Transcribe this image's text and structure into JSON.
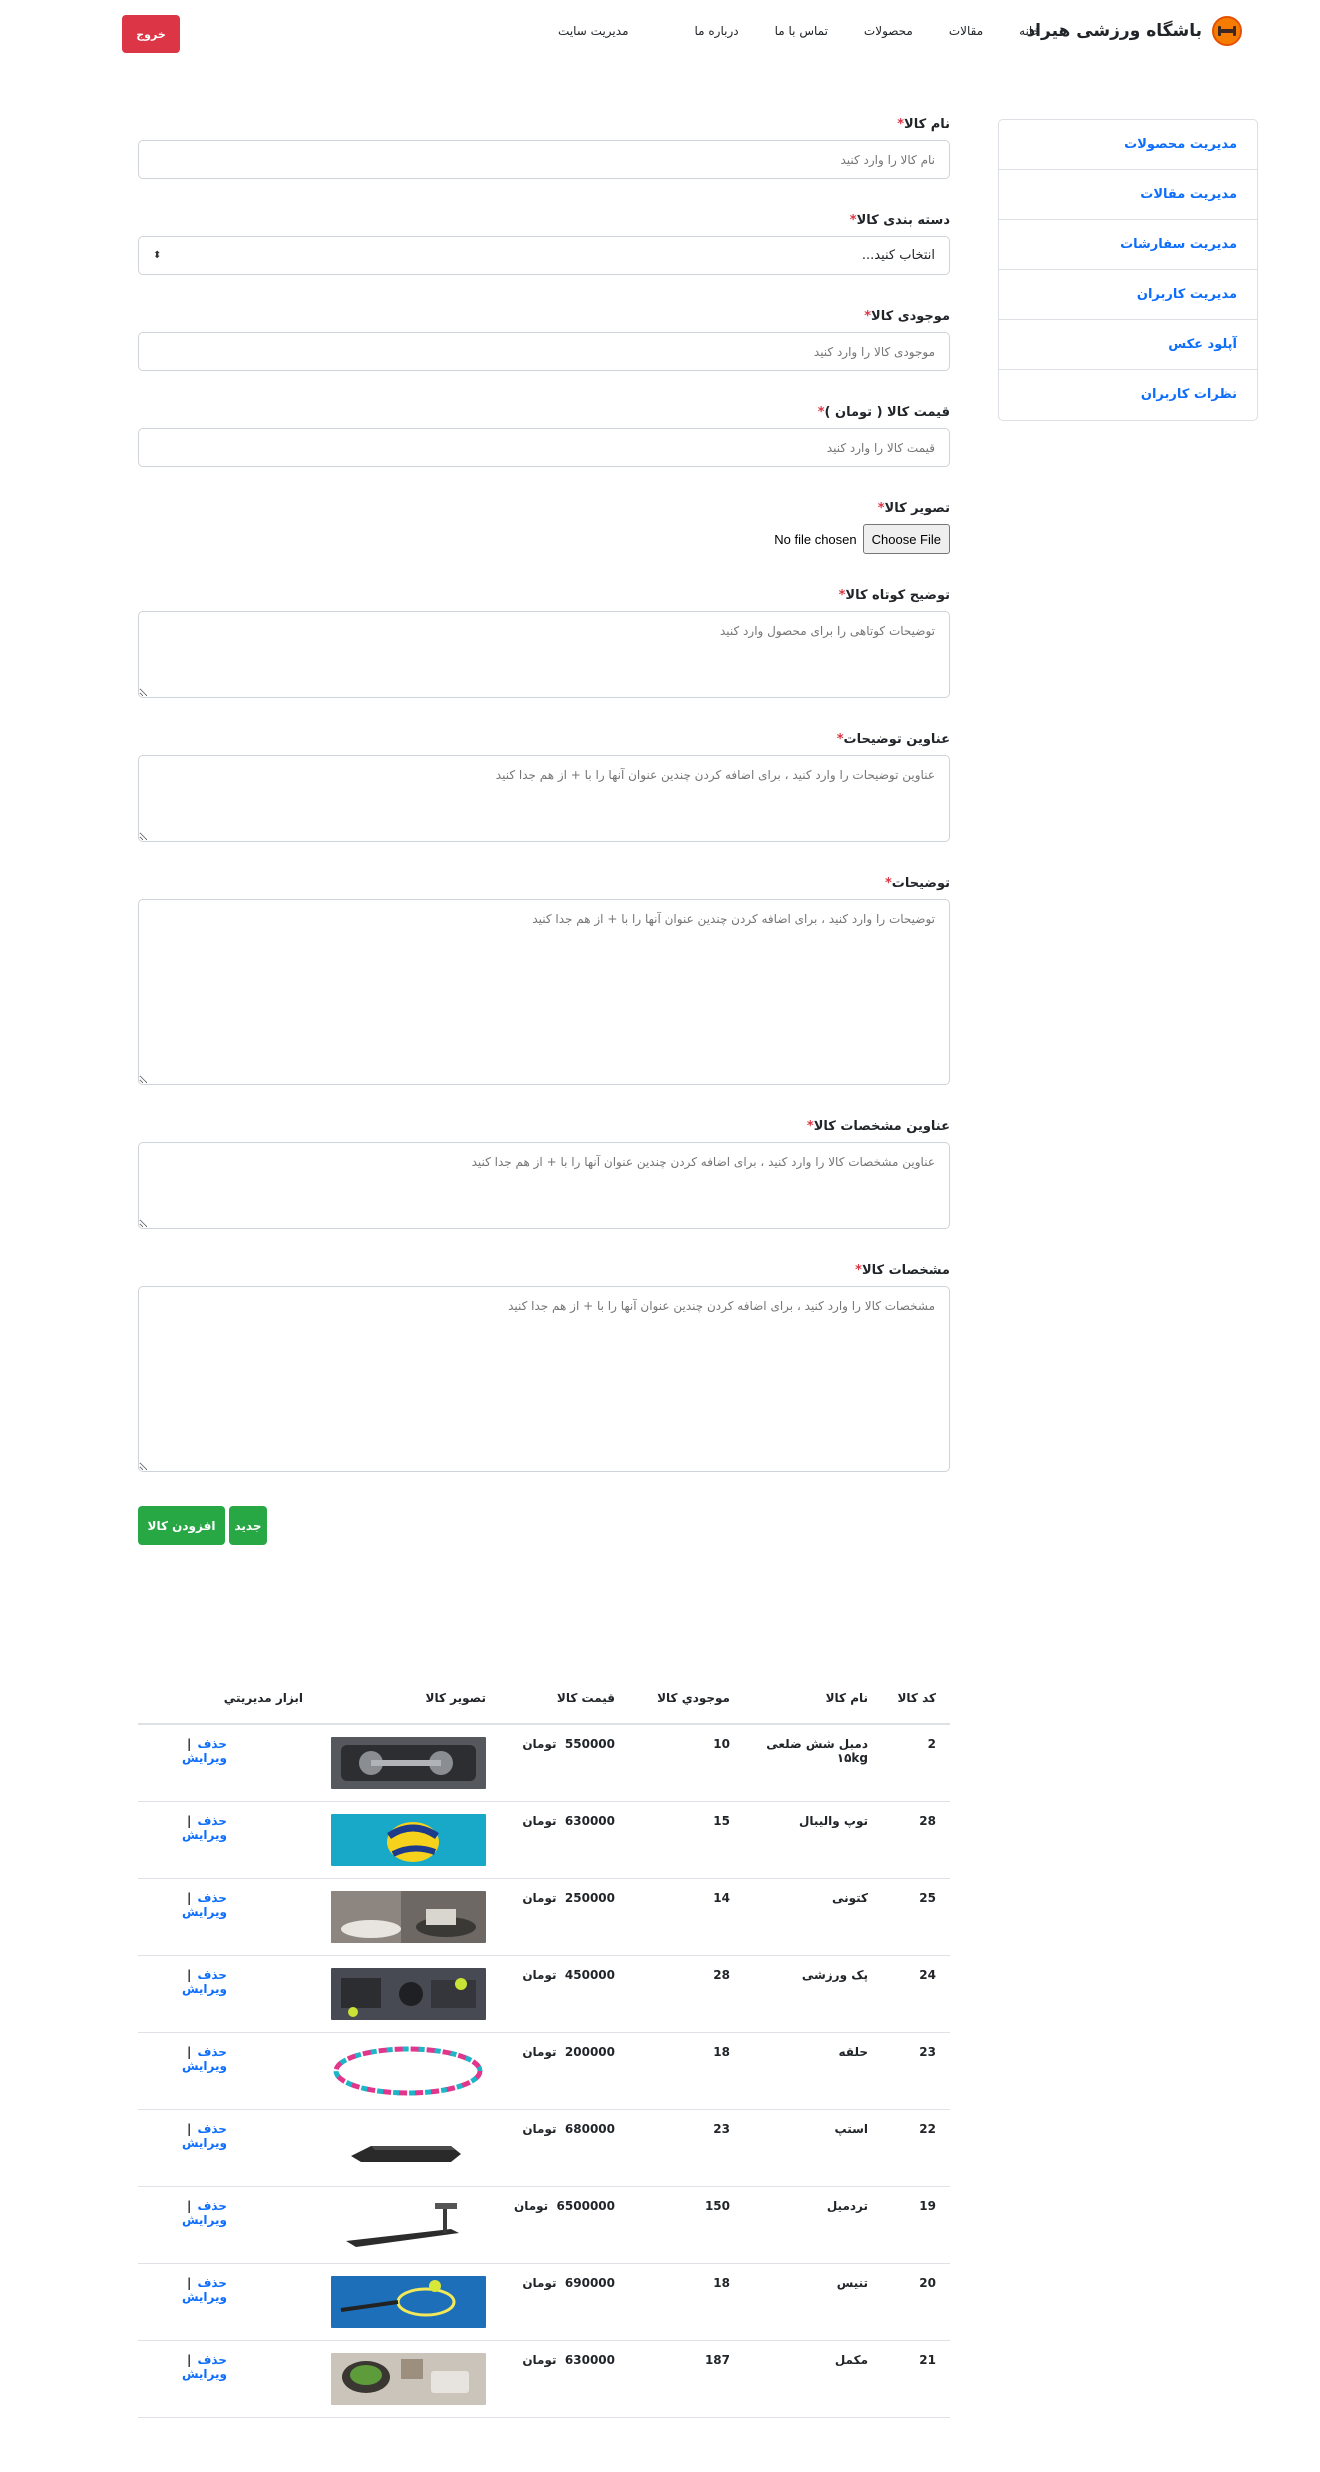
{
  "header": {
    "brand": "باشگاه ورزشی هیراد",
    "nav": [
      "خانه",
      "مقالات",
      "محصولات",
      "تماس با ما",
      "درباره ما"
    ],
    "admin_link": "مدیریت سایت",
    "logout": "خروج"
  },
  "sidebar": {
    "items": [
      {
        "label": "مدیریت محصولات"
      },
      {
        "label": "مدیریت مقالات"
      },
      {
        "label": "مدیریت سفارشات"
      },
      {
        "label": "مدیریت کاربران"
      },
      {
        "label": "آپلود عکس"
      },
      {
        "label": "نظرات کاربران"
      }
    ]
  },
  "form": {
    "name": {
      "label": "نام کالا",
      "placeholder": "نام کالا را وارد کنید"
    },
    "category": {
      "label": "دسته بندی کالا",
      "selected": "انتخاب کنید..."
    },
    "stock": {
      "label": "موجودی کالا",
      "placeholder": "موجودی کالا را وارد کنید"
    },
    "price": {
      "label": "قیمت کالا ( تومان )",
      "placeholder": "قیمت کالا را وارد کنید"
    },
    "image": {
      "label": "تصویر کالا",
      "button": "Choose File",
      "status": "No file chosen"
    },
    "short_desc": {
      "label": "توضیح کوتاه کالا",
      "placeholder": "توضیحات کوتاهی را برای محصول وارد کنید"
    },
    "desc_titles": {
      "label": "عناوین توضیحات",
      "placeholder": "عناوین توضیحات را وارد کنید ، برای اضافه کردن چندین عنوان آنها را با + از هم جدا کنید"
    },
    "desc": {
      "label": "توضیحات",
      "placeholder": "توضیحات را وارد کنید ، برای اضافه کردن چندین عنوان آنها را با + از هم جدا کنید"
    },
    "spec_titles": {
      "label": "عناوین مشخصات کالا",
      "placeholder": "عناوین مشخصات کالا را وارد کنید ، برای اضافه کردن چندین عنوان آنها را با + از هم جدا کنید"
    },
    "specs": {
      "label": "مشخصات کالا",
      "placeholder": "مشخصات کالا را وارد کنید ، برای اضافه کردن چندین عنوان آنها را با + از هم جدا کنید"
    },
    "required_mark": "*",
    "add_button": "افزودن کالا",
    "new_button": "جدید"
  },
  "table": {
    "headers": [
      "کد کالا",
      "نام کالا",
      "موجودي کالا",
      "قیمت کالا",
      "تصویر کالا",
      "ابزار مدیریتي"
    ],
    "currency": "تومان",
    "delete": "حذف",
    "separator": "|",
    "edit": "ویرایش",
    "rows": [
      {
        "id": "2",
        "name": "دمبل شش ضلعی ۱۵kg",
        "stock": "10",
        "price": "550000",
        "thumb": "dumbbell-image",
        "color": "#5a5d62"
      },
      {
        "id": "28",
        "name": "توپ والیبال",
        "stock": "15",
        "price": "630000",
        "thumb": "volleyball-image",
        "color": "#1aa7c4"
      },
      {
        "id": "25",
        "name": "کتونی",
        "stock": "14",
        "price": "250000",
        "thumb": "sneakers-image",
        "color": "#6b6661"
      },
      {
        "id": "24",
        "name": "پک ورزشی",
        "stock": "28",
        "price": "450000",
        "thumb": "sport-pack-image",
        "color": "#4e5159"
      },
      {
        "id": "23",
        "name": "حلقه",
        "stock": "18",
        "price": "200000",
        "thumb": "hula-hoop-image",
        "color": "#ffffff"
      },
      {
        "id": "22",
        "name": "استپ",
        "stock": "23",
        "price": "680000",
        "thumb": "step-image",
        "color": "#ffffff"
      },
      {
        "id": "19",
        "name": "تردمیل",
        "stock": "150",
        "price": "6500000",
        "thumb": "treadmill-image",
        "color": "#ffffff"
      },
      {
        "id": "20",
        "name": "تنیس",
        "stock": "18",
        "price": "690000",
        "thumb": "tennis-image",
        "color": "#1d6fb8"
      },
      {
        "id": "21",
        "name": "مکمل",
        "stock": "187",
        "price": "630000",
        "thumb": "supplement-image",
        "color": "#c9c2b8"
      }
    ]
  }
}
